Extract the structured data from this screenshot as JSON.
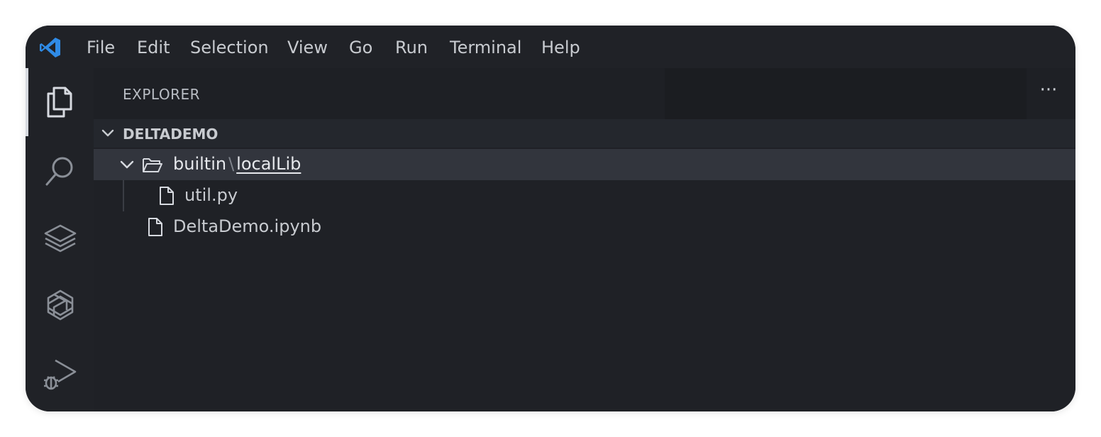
{
  "menu": {
    "items": [
      "File",
      "Edit",
      "Selection",
      "View",
      "Go",
      "Run",
      "Terminal",
      "Help"
    ]
  },
  "activity_bar": {
    "icons": [
      "explorer-icon",
      "search-icon",
      "layers-icon",
      "openai-icon",
      "run-debug-icon"
    ]
  },
  "sidebar": {
    "title": "EXPLORER",
    "more_label": "···",
    "section": {
      "title": "DELTADEMO",
      "expanded": true
    },
    "tree": {
      "folder": {
        "part1": "builtin",
        "separator": "\\",
        "part2": "localLib",
        "expanded": true
      },
      "child_file": "util.py",
      "root_file": "DeltaDemo.ipynb"
    }
  },
  "colors": {
    "accent_blue": "#2f8be6",
    "background": "#1f2126",
    "selected_row": "#32353d"
  }
}
